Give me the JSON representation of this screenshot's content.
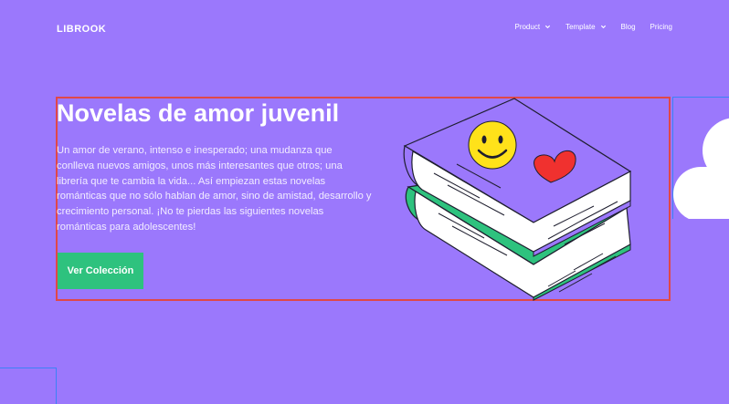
{
  "brand": {
    "name": "LIBROOK"
  },
  "nav": {
    "items": [
      {
        "label": "Product",
        "has_dropdown": true
      },
      {
        "label": "Template",
        "has_dropdown": true
      },
      {
        "label": "Blog",
        "has_dropdown": false
      },
      {
        "label": "Pricing",
        "has_dropdown": false
      }
    ]
  },
  "hero": {
    "title": "Novelas de amor juvenil",
    "description": "Un amor de verano, intenso e inesperado; una mudanza que conlleva nuevos amigos, unos más interesantes que otros; una librería que te cambia la vida... Así empiezan estas novelas románticas que no sólo hablan de amor, sino de amistad, desarrollo y crecimiento personal. ¡No te pierdas las siguientes novelas románticas para adolescentes!",
    "cta_label": "Ver Colección",
    "illustration": "stacked-books-illustration"
  },
  "colors": {
    "background": "#9b78fc",
    "accent_green": "#2ec27e",
    "frame_red": "#e04848",
    "book_cover_purple": "#9b78fc",
    "book_cover_green": "#2ec27e",
    "smiley_yellow": "#ffe21a",
    "heart_red": "#f0312f"
  }
}
